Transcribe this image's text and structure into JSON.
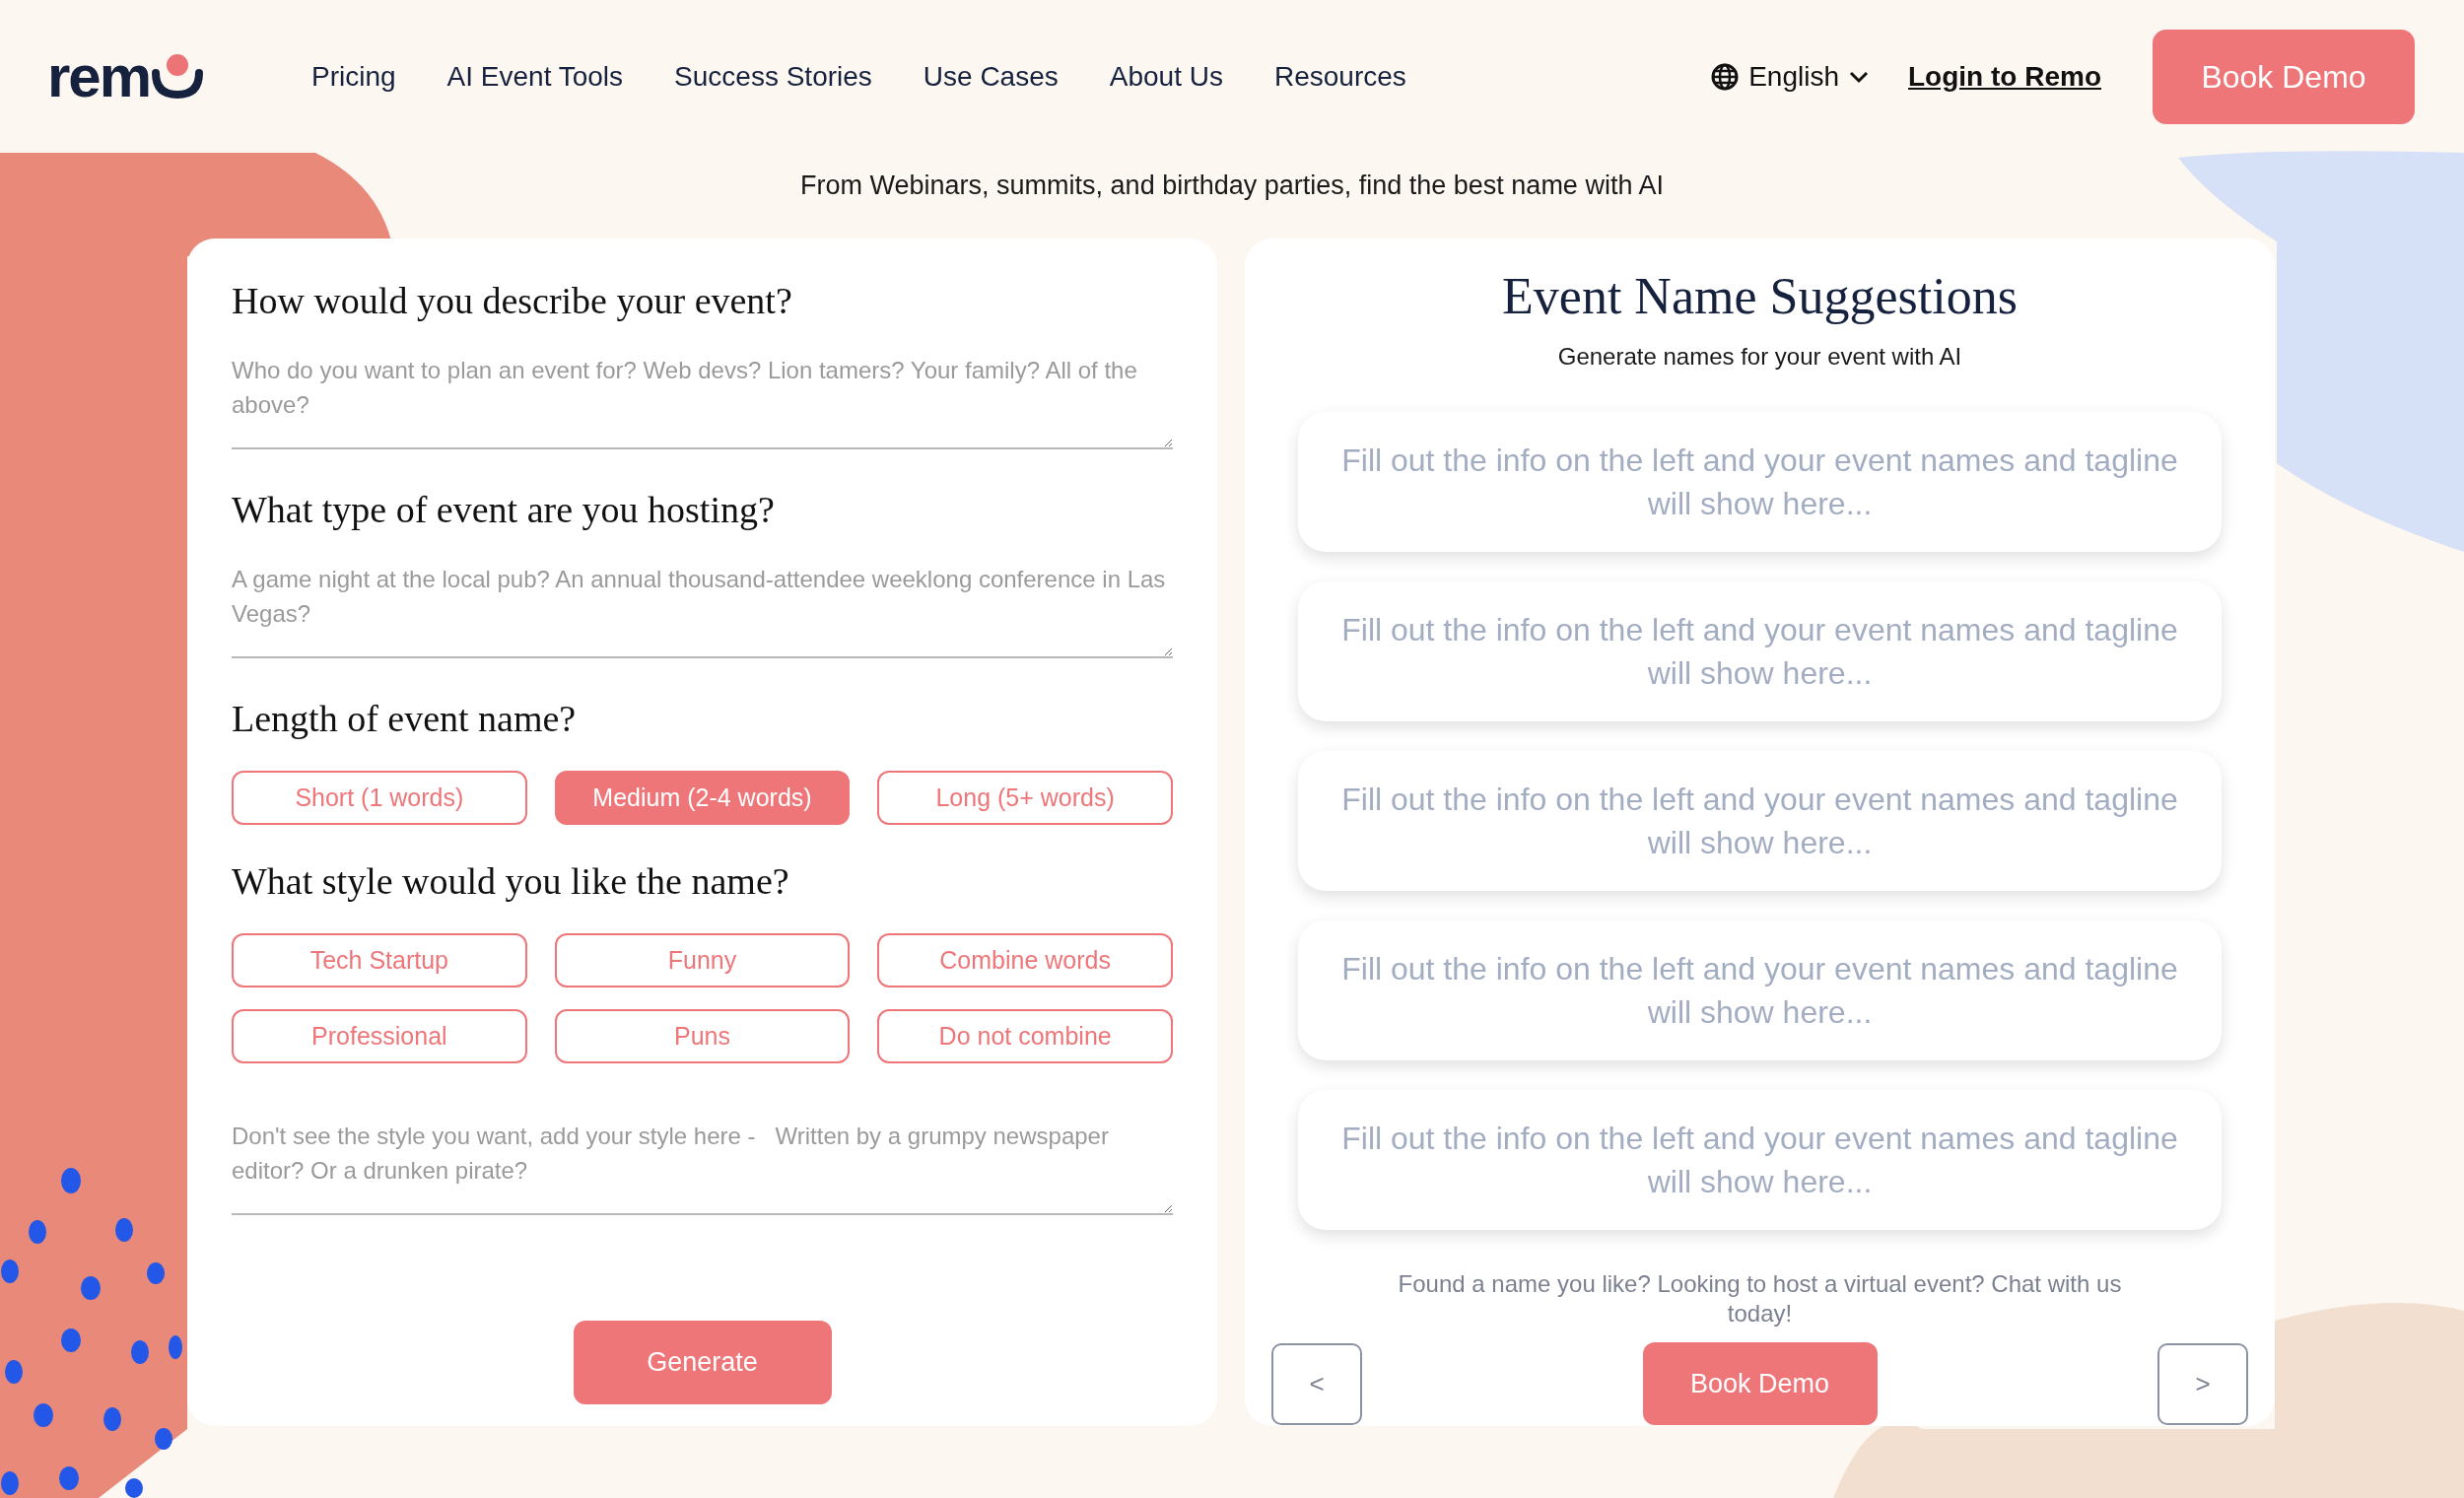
{
  "header": {
    "logo": "rem",
    "nav": [
      "Pricing",
      "AI Event Tools",
      "Success Stories",
      "Use Cases",
      "About Us",
      "Resources"
    ],
    "language": "English",
    "login": "Login to Remo",
    "cta": "Book Demo"
  },
  "tagline": "From Webinars, summits, and birthday parties, find the best name with AI",
  "form": {
    "sections": [
      {
        "kind": "text",
        "heading": "How would you describe your event?",
        "placeholder": "Who do you want to plan an event for? Web devs? Lion tamers? Your family? All of the above?"
      },
      {
        "kind": "text",
        "heading": "What type of event are you hosting?",
        "placeholder": "A game night at the local pub? An annual thousand-attendee weeklong conference in Las Vegas?"
      },
      {
        "kind": "options",
        "heading": "Length of event name?",
        "options": [
          {
            "label": "Short (1 words)",
            "selected": false
          },
          {
            "label": "Medium (2-4 words)",
            "selected": true
          },
          {
            "label": "Long (5+ words)",
            "selected": false
          }
        ]
      },
      {
        "kind": "options",
        "heading": "What style would you like the name?",
        "options": [
          {
            "label": "Tech Startup",
            "selected": false
          },
          {
            "label": "Funny",
            "selected": false
          },
          {
            "label": "Combine words",
            "selected": false
          },
          {
            "label": "Professional",
            "selected": false
          },
          {
            "label": "Puns",
            "selected": false
          },
          {
            "label": "Do not combine",
            "selected": false
          }
        ]
      },
      {
        "kind": "text",
        "placeholder": "Don't see the style you want, add your style here -   Written by a grumpy newspaper editor? Or a drunken pirate?"
      }
    ],
    "submit": "Generate"
  },
  "results": {
    "title": "Event Name Suggestions",
    "subtitle": "Generate names for your event with AI",
    "cards": [
      "Fill out the info on the left and your event names and tagline will show here...",
      "Fill out the info on the left and your event names and tagline will show here...",
      "Fill out the info on the left and your event names and tagline will show here...",
      "Fill out the info on the left and your event names and tagline will show here...",
      "Fill out the info on the left and your event names and tagline will show here..."
    ],
    "footer": "Found a name you like? Looking to host a virtual event? Chat with us today!",
    "prev": "<",
    "cta": "Book Demo",
    "next": ">"
  }
}
